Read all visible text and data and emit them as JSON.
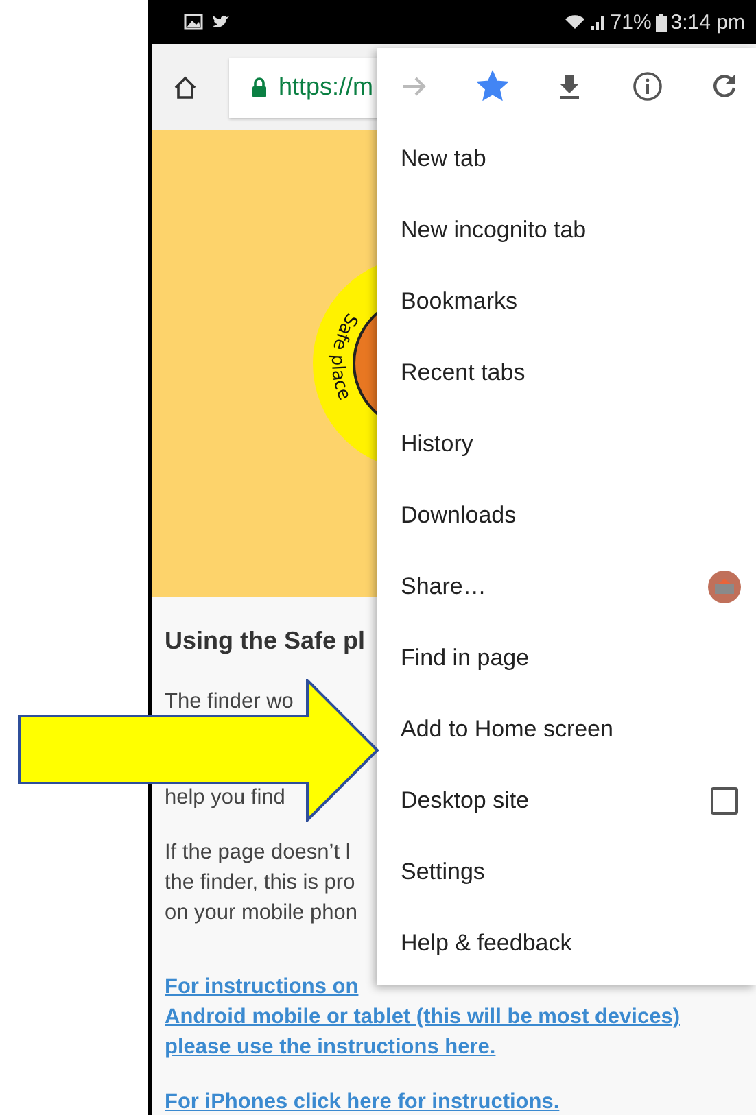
{
  "status_bar": {
    "battery": "71%",
    "time": "3:14 pm"
  },
  "toolbar": {
    "url": "https://m"
  },
  "hero": {
    "logo_text": "Safe place"
  },
  "article": {
    "heading": "Using the Safe pl",
    "paragraphs": [
      {
        "lines": [
          [
            "The finder wo"
          ],
          [
            "help you find"
          ]
        ]
      },
      {
        "lines": [
          [
            "If the page doesn’t l"
          ],
          [
            "the finder, this is pro"
          ],
          [
            "on your mobile phon"
          ]
        ]
      }
    ],
    "links": [
      {
        "lines": [
          "For instructions on",
          "Android mobile or tablet (this will be most devices)",
          "please use the instructions here."
        ]
      },
      {
        "lines": [
          "For iPhones click here for instructions."
        ]
      }
    ]
  },
  "menu": {
    "actions": [
      {
        "kind": "forward",
        "disabled": true
      },
      {
        "kind": "bookmark",
        "on": true
      },
      {
        "kind": "download",
        "disabled": false
      },
      {
        "kind": "info",
        "disabled": false
      },
      {
        "kind": "reload",
        "disabled": false
      }
    ],
    "items": [
      {
        "label": "New tab",
        "kind": "plain"
      },
      {
        "label": "New incognito tab",
        "kind": "plain"
      },
      {
        "label": "Bookmarks",
        "kind": "plain"
      },
      {
        "label": "Recent tabs",
        "kind": "plain"
      },
      {
        "label": "History",
        "kind": "plain"
      },
      {
        "label": "Downloads",
        "kind": "plain"
      },
      {
        "label": "Share…",
        "kind": "share"
      },
      {
        "label": "Find in page",
        "kind": "plain"
      },
      {
        "label": "Add to Home screen",
        "kind": "plain"
      },
      {
        "label": "Desktop site",
        "kind": "checkbox",
        "checked": false
      },
      {
        "label": "Settings",
        "kind": "plain"
      },
      {
        "label": "Help & feedback",
        "kind": "plain"
      }
    ]
  },
  "annotation": {
    "kind": "arrow"
  }
}
